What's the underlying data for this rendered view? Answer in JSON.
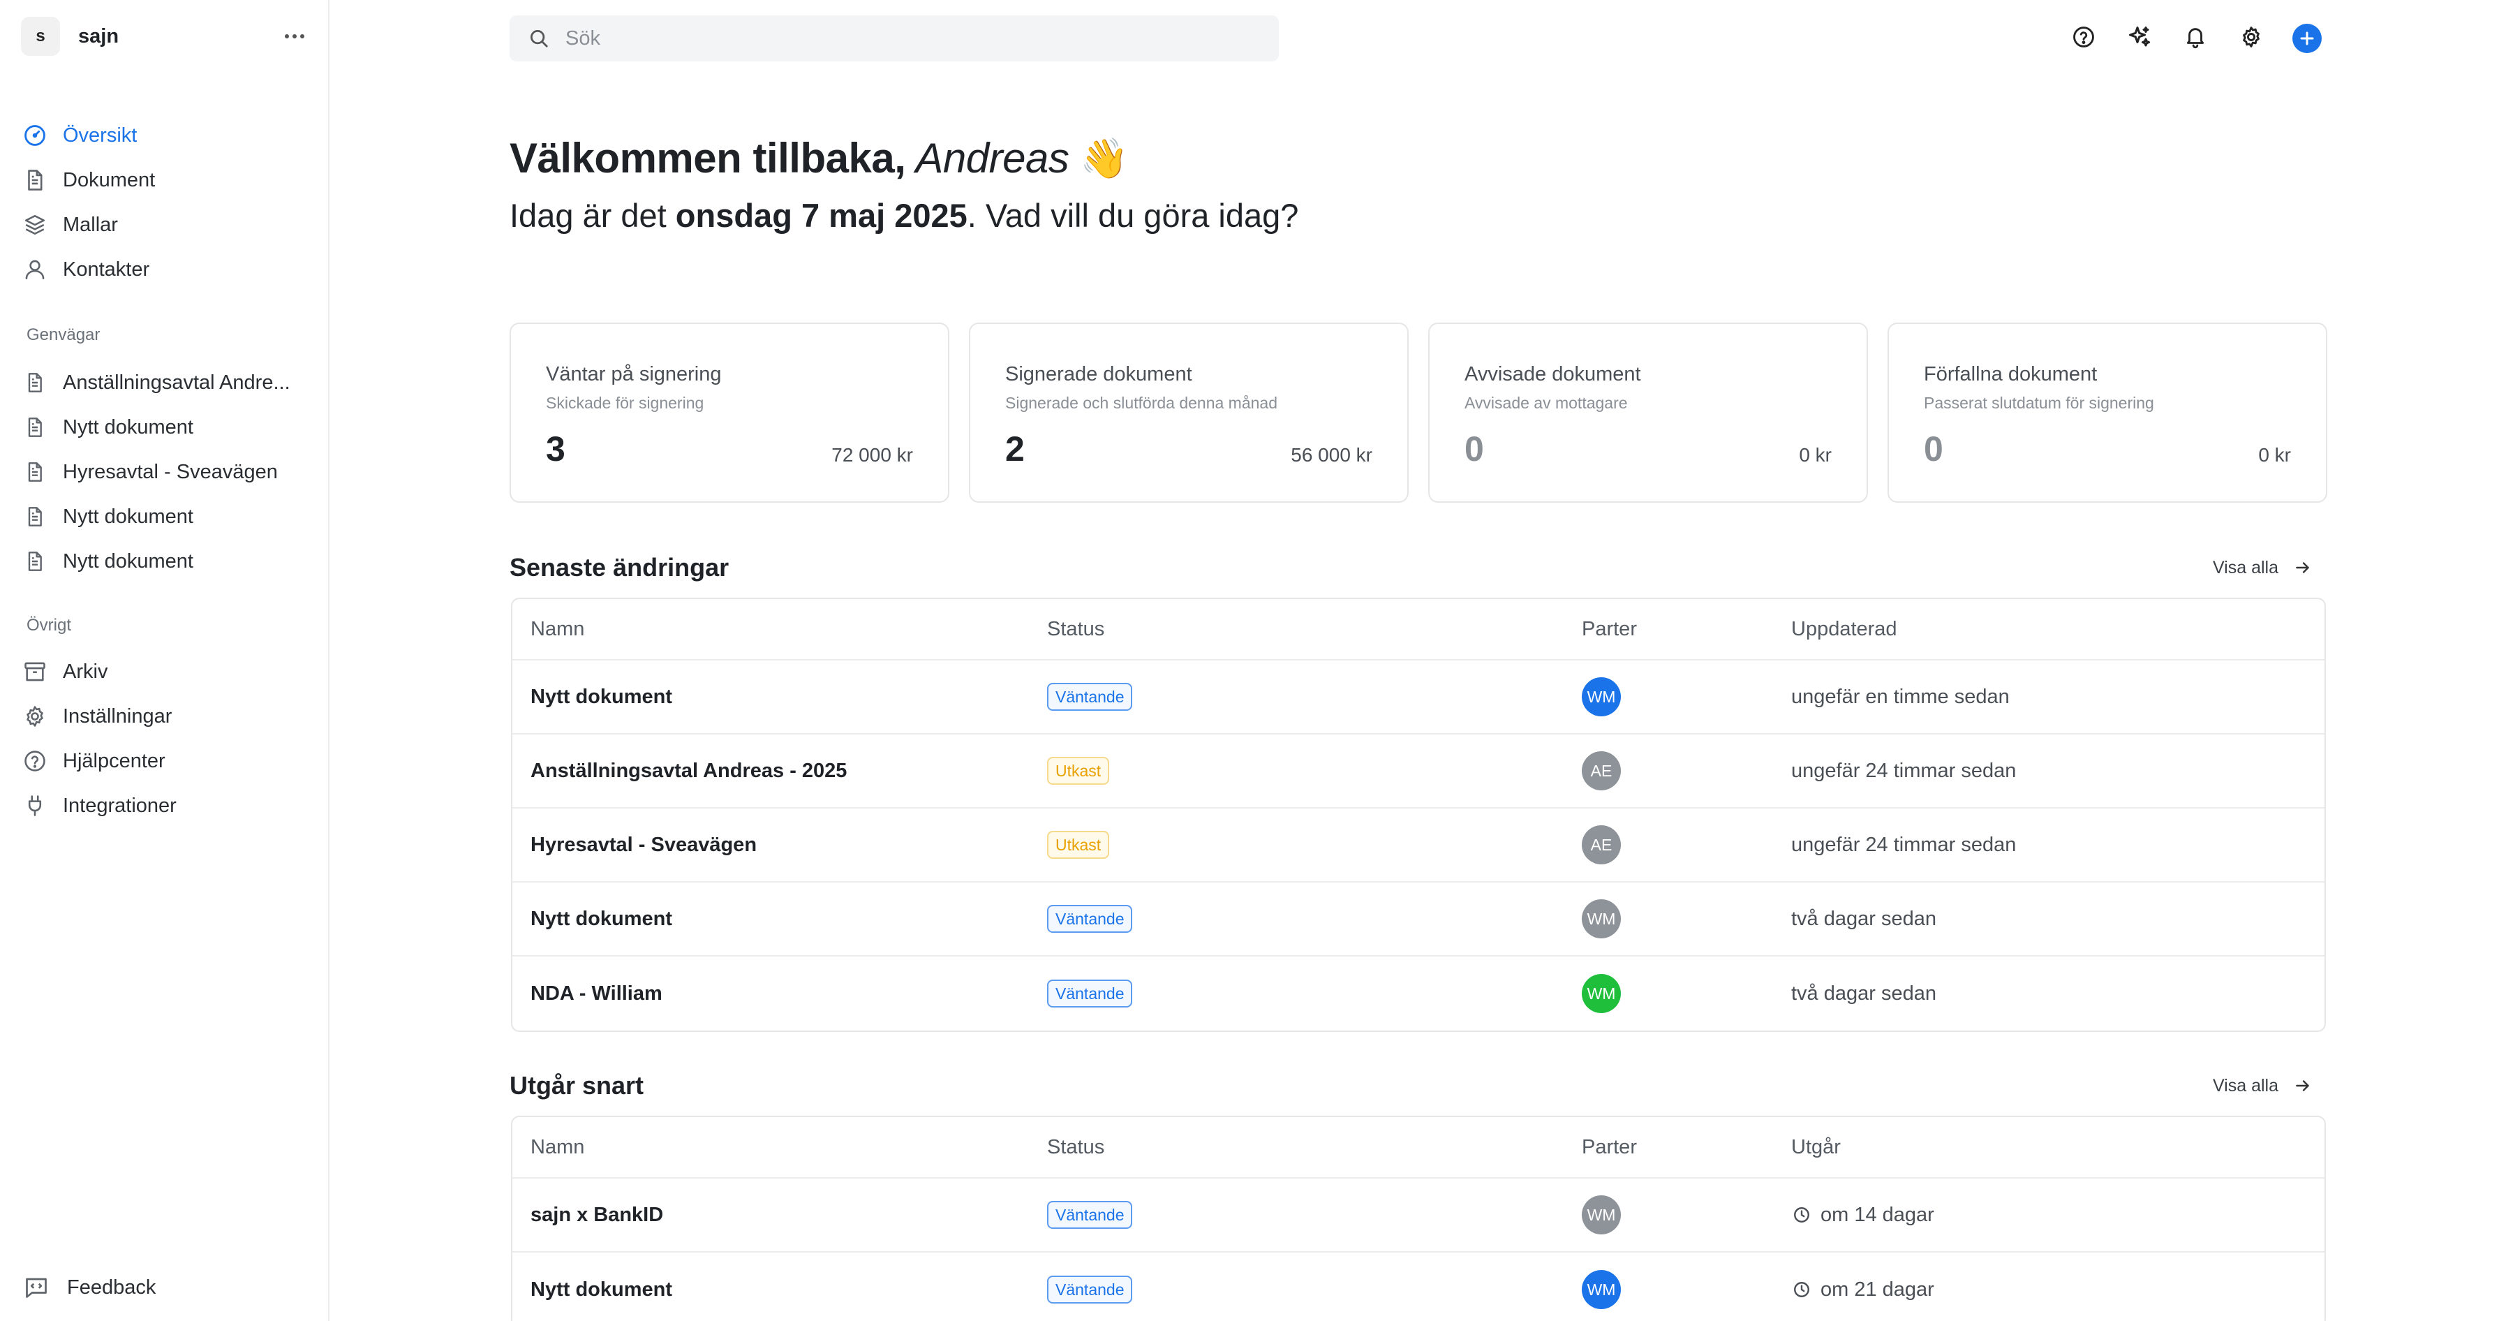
{
  "workspace": {
    "initial": "s",
    "name": "sajn"
  },
  "nav": {
    "main": [
      {
        "label": "Översikt",
        "icon": "gauge-icon",
        "active": true
      },
      {
        "label": "Dokument",
        "icon": "document-icon"
      },
      {
        "label": "Mallar",
        "icon": "layers-icon"
      },
      {
        "label": "Kontakter",
        "icon": "user-icon"
      }
    ],
    "shortcuts_title": "Genvägar",
    "shortcuts": [
      {
        "label": "Anställningsavtal Andre..."
      },
      {
        "label": "Nytt dokument"
      },
      {
        "label": "Hyresavtal - Sveavägen"
      },
      {
        "label": "Nytt dokument"
      },
      {
        "label": "Nytt dokument"
      }
    ],
    "other_title": "Övrigt",
    "other": [
      {
        "label": "Arkiv",
        "icon": "archive-icon"
      },
      {
        "label": "Inställningar",
        "icon": "gear-icon"
      },
      {
        "label": "Hjälpcenter",
        "icon": "help-circle-icon"
      },
      {
        "label": "Integrationer",
        "icon": "plug-icon"
      }
    ],
    "feedback": "Feedback"
  },
  "search": {
    "placeholder": "Sök"
  },
  "welcome": {
    "greeting": "Välkommen tillbaka,",
    "name": "Andreas",
    "wave": "👋",
    "today_prefix": "Idag är det",
    "date": "onsdag 7 maj 2025",
    "today_suffix": ". Vad vill du göra idag?"
  },
  "cards": [
    {
      "title": "Väntar på signering",
      "subtitle": "Skickade för signering",
      "count": "3",
      "amount": "72 000 kr"
    },
    {
      "title": "Signerade dokument",
      "subtitle": "Signerade och slutförda denna månad",
      "count": "2",
      "amount": "56 000 kr"
    },
    {
      "title": "Avvisade dokument",
      "subtitle": "Avvisade av mottagare",
      "count": "0",
      "amount": "0 kr"
    },
    {
      "title": "Förfallna dokument",
      "subtitle": "Passerat slutdatum för signering",
      "count": "0",
      "amount": "0 kr"
    }
  ],
  "recent": {
    "title": "Senaste ändringar",
    "view_all": "Visa alla",
    "columns": {
      "name": "Namn",
      "status": "Status",
      "parties": "Parter",
      "updated": "Uppdaterad"
    },
    "rows": [
      {
        "name": "Nytt dokument",
        "status": "Väntande",
        "status_kind": "pending",
        "party": "WM",
        "party_color": "#1a73e8",
        "updated": "ungefär en timme sedan"
      },
      {
        "name": "Anställningsavtal Andreas - 2025",
        "status": "Utkast",
        "status_kind": "draft",
        "party": "AE",
        "party_color": "#8e9399",
        "updated": "ungefär 24 timmar sedan"
      },
      {
        "name": "Hyresavtal - Sveavägen",
        "status": "Utkast",
        "status_kind": "draft",
        "party": "AE",
        "party_color": "#8e9399",
        "updated": "ungefär 24 timmar sedan"
      },
      {
        "name": "Nytt dokument",
        "status": "Väntande",
        "status_kind": "pending",
        "party": "WM",
        "party_color": "#8e9399",
        "updated": "två dagar sedan"
      },
      {
        "name": "NDA - William",
        "status": "Väntande",
        "status_kind": "pending",
        "party": "WM",
        "party_color": "#1fbf3c",
        "updated": "två dagar sedan"
      }
    ]
  },
  "expiring": {
    "title": "Utgår snart",
    "view_all": "Visa alla",
    "columns": {
      "name": "Namn",
      "status": "Status",
      "parties": "Parter",
      "expires": "Utgår"
    },
    "rows": [
      {
        "name": "sajn x BankID",
        "status": "Väntande",
        "status_kind": "pending",
        "party": "WM",
        "party_color": "#8e9399",
        "expires": "om 14 dagar"
      },
      {
        "name": "Nytt dokument",
        "status": "Väntande",
        "status_kind": "pending",
        "party": "WM",
        "party_color": "#1a73e8",
        "expires": "om 21 dagar"
      }
    ]
  },
  "colors": {
    "accent": "#1a73e8",
    "pending": "#1a73e8",
    "draft": "#e8a100",
    "green": "#1fbf3c",
    "gray": "#8e9399"
  }
}
